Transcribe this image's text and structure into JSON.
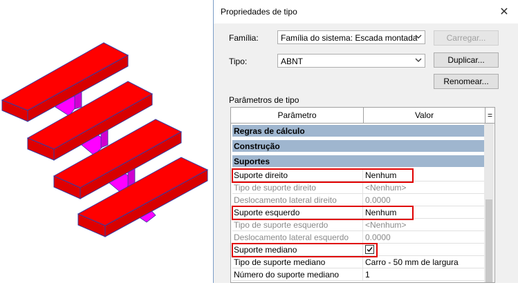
{
  "dialog": {
    "title": "Propriedades de tipo",
    "family_label": "Família:",
    "family_value": "Família do sistema: Escada montada",
    "type_label": "Tipo:",
    "type_value": "ABNT",
    "load_button": "Carregar...",
    "duplicate_button": "Duplicar...",
    "rename_button": "Renomear...",
    "params_label": "Parâmetros de tipo"
  },
  "grid": {
    "col_param": "Parâmetro",
    "col_value": "Valor",
    "col_eq": "=",
    "groups": [
      {
        "label": "Regras de cálculo",
        "icon": "»"
      },
      {
        "label": "Construção",
        "icon": "»"
      },
      {
        "label": "Suportes",
        "icon": "«"
      }
    ],
    "rows": [
      {
        "param": "Suporte direito",
        "value": "Nenhum"
      },
      {
        "param": "Tipo de suporte direito",
        "value": "<Nenhum>"
      },
      {
        "param": "Deslocamento lateral direito",
        "value": "0.0000"
      },
      {
        "param": "Suporte esquerdo",
        "value": "Nenhum"
      },
      {
        "param": "Tipo de suporte esquerdo",
        "value": "<Nenhum>"
      },
      {
        "param": "Deslocamento lateral esquerdo",
        "value": "0.0000"
      },
      {
        "param": "Suporte mediano",
        "value": ""
      },
      {
        "param": "Tipo de suporte mediano",
        "value": "Carro - 50 mm de largura"
      },
      {
        "param": "Número do suporte mediano",
        "value": "1"
      }
    ],
    "mid_support_checked": true
  },
  "colors": {
    "tread": "#ff0000",
    "tread_edge": "#3a3aa0",
    "support": "#ff00ff",
    "group_band": "#9fb6cf",
    "highlight_box": "#e00000"
  }
}
